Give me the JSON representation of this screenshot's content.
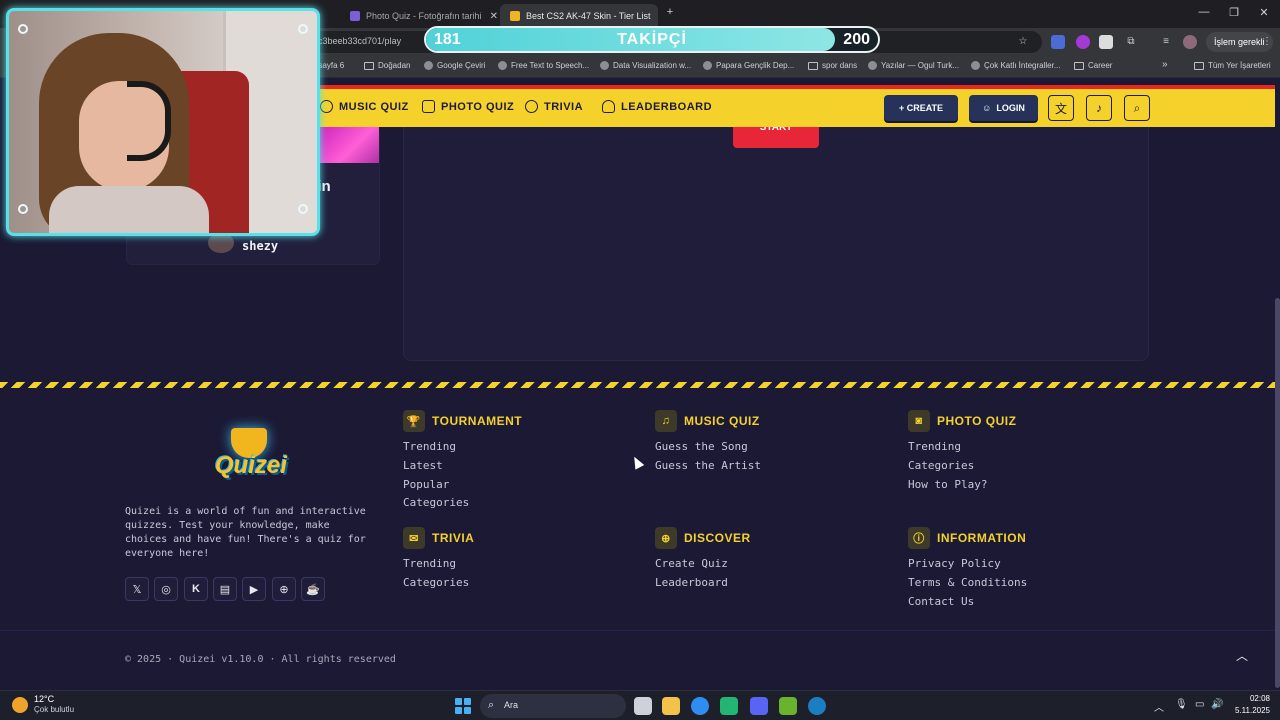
{
  "browser": {
    "tabs": [
      {
        "label": "Photo Quiz - Fotoğrafın tarihi"
      },
      {
        "label": "Best CS2 AK-47 Skin - Tier List"
      }
    ],
    "new_tab_label": "+",
    "address_url": "c3beeb33cd701/play",
    "profile_label": "İşlem gerekli",
    "bookmarks": [
      "t sayfa 6",
      "Doğadan",
      "Google Çeviri",
      "Free Text to Speech...",
      "Data Visualization w...",
      "Papara Gençlik Dep...",
      "spor dans",
      "Yazılar — Ogul Turk...",
      "Çok Katlı İntegraller...",
      "Career"
    ],
    "bookmarks_more": "»",
    "all_bookmarks": "Tüm Yer İşaretleri"
  },
  "follow_goal": {
    "current": "181",
    "label": "TAKİPÇİ",
    "target": "200",
    "progress": 0.905
  },
  "nav": {
    "items": [
      "MUSIC QUIZ",
      "PHOTO QUIZ",
      "TRIVIA",
      "LEADERBOARD"
    ],
    "create_label": "+ CREATE",
    "login_label": "LOGIN"
  },
  "card": {
    "title_fragment": "kin",
    "author": "shezy"
  },
  "panel": {
    "start_label": "START"
  },
  "footer": {
    "logo_text": "Quizei",
    "about": "Quizei is a world of fun and interactive quizzes. Test your knowledge, make choices and have fun! There's a quiz for everyone here!",
    "socials": [
      "x-icon",
      "instagram-icon",
      "kick-icon",
      "twitch-icon",
      "youtube-icon",
      "globe-icon",
      "coffee-icon"
    ],
    "columns": [
      {
        "title": "TOURNAMENT",
        "icon": "trophy-icon",
        "links": [
          "Trending",
          "Latest",
          "Popular",
          "Categories"
        ]
      },
      {
        "title": "MUSIC QUIZ",
        "icon": "music-icon",
        "links": [
          "Guess the Song",
          "Guess the Artist"
        ]
      },
      {
        "title": "PHOTO QUIZ",
        "icon": "camera-icon",
        "links": [
          "Trending",
          "Categories",
          "How to Play?"
        ]
      },
      {
        "title": "TRIVIA",
        "icon": "chat-icon",
        "links": [
          "Trending",
          "Categories"
        ]
      },
      {
        "title": "DISCOVER",
        "icon": "globe-icon",
        "links": [
          "Create Quiz",
          "Leaderboard"
        ]
      },
      {
        "title": "INFORMATION",
        "icon": "info-icon",
        "links": [
          "Privacy Policy",
          "Terms & Conditions",
          "Contact Us"
        ]
      }
    ],
    "copyright": "© 2025 · Quizei v1.10.0 · All rights reserved"
  },
  "taskbar": {
    "weather_temp": "12°C",
    "weather_desc": "Çok bulutlu",
    "search_label": "Ara",
    "time": "02:08",
    "date": "5.11.2025"
  },
  "colors": {
    "nav_yellow": "#f5d12c",
    "nav_red": "#e8271f",
    "page_bg": "#1b1934",
    "webcam_frame": "#57e1e8",
    "start_red": "#e8263a"
  }
}
